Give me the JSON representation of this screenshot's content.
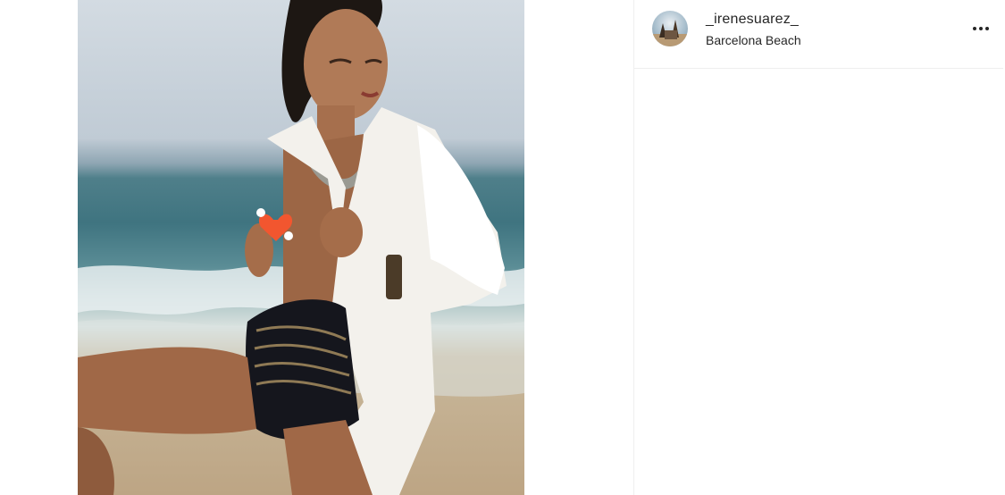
{
  "post": {
    "image_description": "",
    "author": {
      "username": "_irenesuarez_",
      "location": "Barcelona Beach"
    },
    "options_icon": "more-horizontal-icon"
  },
  "colors": {
    "text": "#262626",
    "divider": "#efefef",
    "background": "#ffffff"
  }
}
